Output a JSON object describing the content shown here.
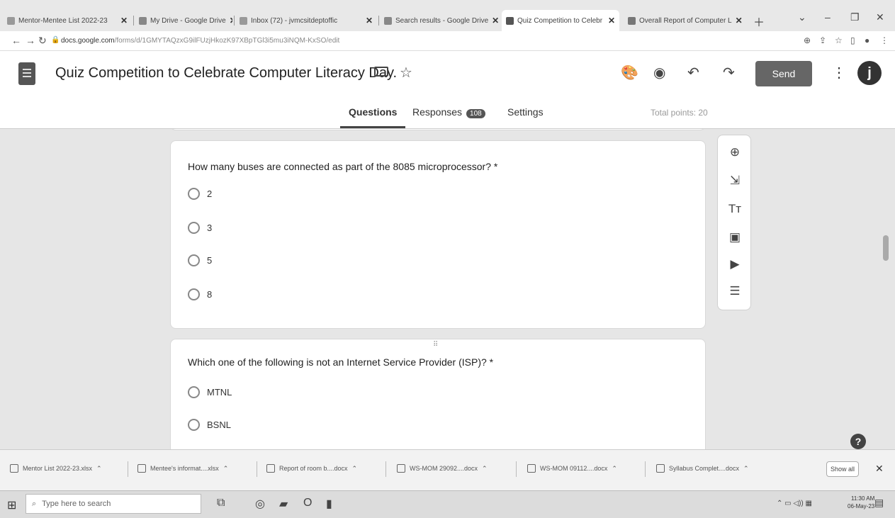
{
  "browser": {
    "tabs": [
      {
        "label": "Mentor-Mentee List 2022-23",
        "active": false
      },
      {
        "label": "My Drive - Google Drive",
        "active": false
      },
      {
        "label": "Inbox (72) - jvmcsitdeptoffic",
        "active": false
      },
      {
        "label": "Search results - Google Drive",
        "active": false
      },
      {
        "label": "Quiz Competition to Celebr",
        "active": true
      },
      {
        "label": "Overall Report of Computer L",
        "active": false
      }
    ],
    "new_tab_icon": "plus-icon",
    "url_host": "docs.google.com",
    "url_path": "/forms/d/1GMYTAQzxG9ilFUzjHkozK97XBpTGl3i5mu3iNQM-KxSO/edit"
  },
  "form": {
    "title": "Quiz Competition to Celebrate Computer Literacy Day.",
    "send_label": "Send",
    "avatar_letter": "j",
    "tabs": {
      "questions": "Questions",
      "responses": "Responses",
      "responses_count": "108",
      "settings": "Settings"
    },
    "total_points": "Total points: 20"
  },
  "questions": [
    {
      "text": "How many buses are connected as part of the 8085 microprocessor? *",
      "options": [
        "2",
        "3",
        "5",
        "8"
      ]
    },
    {
      "text": "Which one of the following is not an Internet Service Provider (ISP)? *",
      "options": [
        "MTNL",
        "BSNL"
      ]
    }
  ],
  "drag_handle": "⠿",
  "side_tools": [
    "add-question-icon",
    "import-questions-icon",
    "add-title-icon",
    "add-image-icon",
    "add-video-icon",
    "add-section-icon"
  ],
  "downloads": [
    "Mentor List 2022-23.xlsx",
    "Mentee's informat....xlsx",
    "Report of room b....docx",
    "WS-MOM 29092....docx",
    "WS-MOM 09112....docx",
    "Syllabus Complet....docx"
  ],
  "downloads_show_all": "Show all",
  "taskbar": {
    "search_placeholder": "Type here to search",
    "time": "11:30 AM",
    "date": "06-May-23"
  },
  "colors": {
    "accent": "#666666",
    "header_bg": "#ffffff",
    "canvas_bg": "#e6e6e6"
  }
}
